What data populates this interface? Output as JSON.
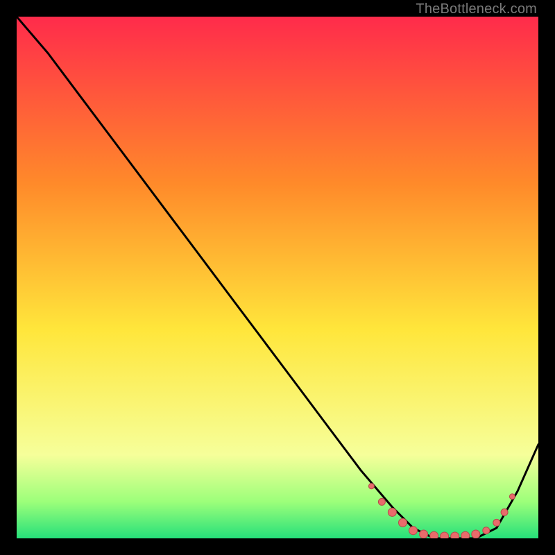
{
  "watermark": "TheBottleneck.com",
  "colors": {
    "gradient_top": "#ff2b4b",
    "gradient_mid1": "#ff8a2a",
    "gradient_mid2": "#ffe63b",
    "gradient_low": "#f6ff9a",
    "gradient_green1": "#9cff7a",
    "gradient_green2": "#26e07a",
    "curve": "#000000",
    "marker": "#e86b6b",
    "marker_stroke": "#b74a4a"
  },
  "chart_data": {
    "type": "line",
    "title": "",
    "xlabel": "",
    "ylabel": "",
    "xlim": [
      0,
      100
    ],
    "ylim": [
      0,
      100
    ],
    "series": [
      {
        "name": "bottleneck-curve",
        "x": [
          0,
          6,
          12,
          18,
          24,
          30,
          36,
          42,
          48,
          54,
          60,
          66,
          72,
          76,
          80,
          84,
          88,
          92,
          96,
          100
        ],
        "y": [
          100,
          93,
          85,
          77,
          69,
          61,
          53,
          45,
          37,
          29,
          21,
          13,
          6,
          2,
          0,
          0,
          0,
          2,
          9,
          18
        ]
      }
    ],
    "markers": {
      "name": "highlight-dots",
      "points": [
        {
          "x": 68,
          "y": 10,
          "r": 4
        },
        {
          "x": 70,
          "y": 7,
          "r": 5
        },
        {
          "x": 72,
          "y": 5,
          "r": 6
        },
        {
          "x": 74,
          "y": 3,
          "r": 6
        },
        {
          "x": 76,
          "y": 1.5,
          "r": 6
        },
        {
          "x": 78,
          "y": 0.8,
          "r": 6
        },
        {
          "x": 80,
          "y": 0.5,
          "r": 6
        },
        {
          "x": 82,
          "y": 0.4,
          "r": 6
        },
        {
          "x": 84,
          "y": 0.4,
          "r": 6
        },
        {
          "x": 86,
          "y": 0.5,
          "r": 6
        },
        {
          "x": 88,
          "y": 0.8,
          "r": 6
        },
        {
          "x": 90,
          "y": 1.5,
          "r": 5
        },
        {
          "x": 92,
          "y": 3,
          "r": 5
        },
        {
          "x": 93.5,
          "y": 5,
          "r": 5
        },
        {
          "x": 95,
          "y": 8,
          "r": 4
        }
      ]
    }
  }
}
